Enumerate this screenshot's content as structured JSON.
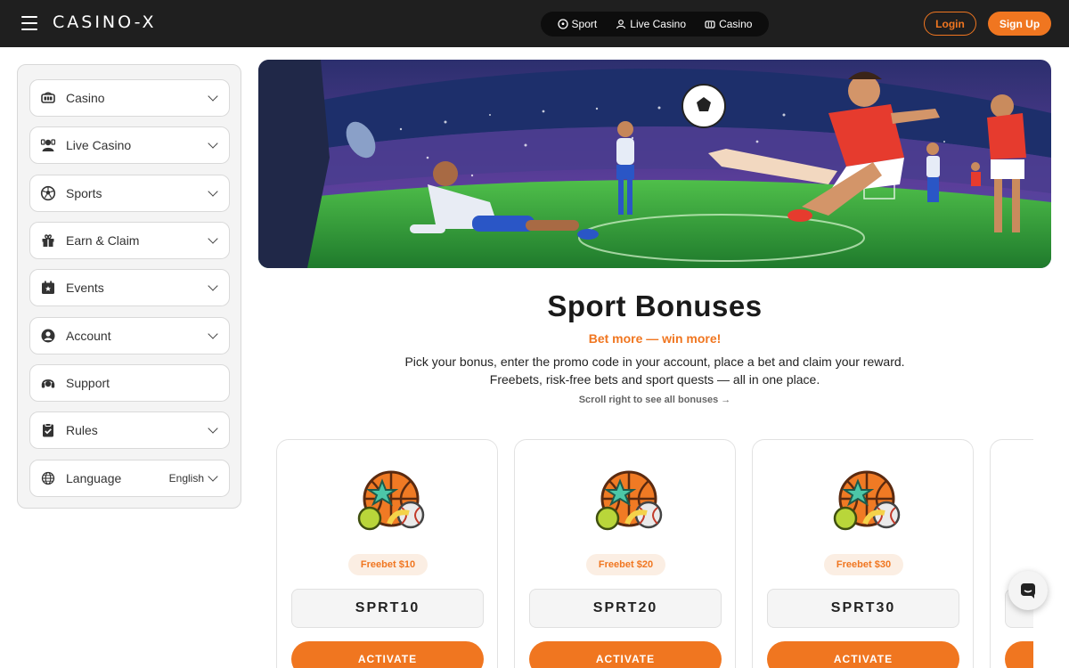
{
  "header": {
    "logo": "CASINO-X",
    "nav": [
      {
        "label": "Sport",
        "icon": "soccer-ball-icon"
      },
      {
        "label": "Live Casino",
        "icon": "dealer-icon"
      },
      {
        "label": "Casino",
        "icon": "slot-icon"
      }
    ],
    "login_label": "Login",
    "signup_label": "Sign Up"
  },
  "sidebar": {
    "items": [
      {
        "label": "Casino",
        "icon": "slot-icon",
        "expandable": true
      },
      {
        "label": "Live Casino",
        "icon": "dealer-icon",
        "expandable": true
      },
      {
        "label": "Sports",
        "icon": "soccer-ball-icon",
        "expandable": true
      },
      {
        "label": "Earn & Claim",
        "icon": "gift-icon",
        "expandable": true
      },
      {
        "label": "Events",
        "icon": "calendar-star-icon",
        "expandable": true
      },
      {
        "label": "Account",
        "icon": "user-icon",
        "expandable": true
      },
      {
        "label": "Support",
        "icon": "support-icon",
        "expandable": false
      },
      {
        "label": "Rules",
        "icon": "clipboard-check-icon",
        "expandable": true
      },
      {
        "label": "Language",
        "icon": "globe-icon",
        "expandable": true,
        "value": "English"
      }
    ]
  },
  "promo": {
    "title": "Sport Bonuses",
    "subtitle": "Bet more — win more!",
    "description_line1": "Pick your bonus, enter the promo code in your account, place a bet and claim your reward.",
    "description_line2": "Freebets, risk-free bets and sport quests — all in one place.",
    "scroll_hint": "Scroll right to see all bonuses →"
  },
  "bonuses": [
    {
      "badge": "Freebet $10",
      "code": "SPRT10",
      "button": "ACTIVATE"
    },
    {
      "badge": "Freebet $20",
      "code": "SPRT20",
      "button": "ACTIVATE"
    },
    {
      "badge": "Freebet $30",
      "code": "SPRT30",
      "button": "ACTIVATE"
    }
  ],
  "colors": {
    "accent": "#f07620",
    "topbar": "#1f1f1f",
    "badge_bg": "#fbeee3"
  }
}
